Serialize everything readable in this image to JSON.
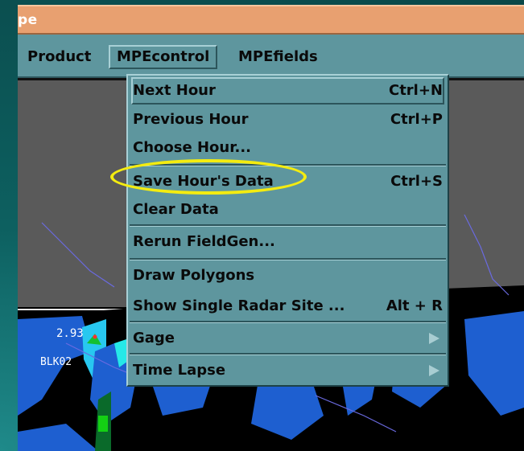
{
  "window": {
    "title_fragment": "pe"
  },
  "menubar": {
    "items": [
      {
        "label": "Product"
      },
      {
        "label": "MPEcontrol"
      },
      {
        "label": "MPEfields"
      }
    ]
  },
  "mpecontrol_menu": {
    "items": [
      {
        "label": "Next Hour",
        "shortcut": "Ctrl+N"
      },
      {
        "label": "Previous Hour",
        "shortcut": "Ctrl+P"
      },
      {
        "label": "Choose Hour...",
        "shortcut": ""
      },
      {
        "label": "Save Hour's Data",
        "shortcut": "Ctrl+S"
      },
      {
        "label": "Clear Data",
        "shortcut": ""
      },
      {
        "label": "Rerun FieldGen...",
        "shortcut": ""
      },
      {
        "label": "Draw Polygons",
        "shortcut": ""
      },
      {
        "label": "Show Single Radar Site ...",
        "shortcut": "Alt + R"
      },
      {
        "label": "Gage",
        "shortcut": ""
      },
      {
        "label": "Time Lapse",
        "shortcut": ""
      }
    ]
  },
  "map": {
    "gage_value": "2.93",
    "gage_id": "BLK02"
  },
  "highlight": {
    "color": "#f4ec10"
  }
}
